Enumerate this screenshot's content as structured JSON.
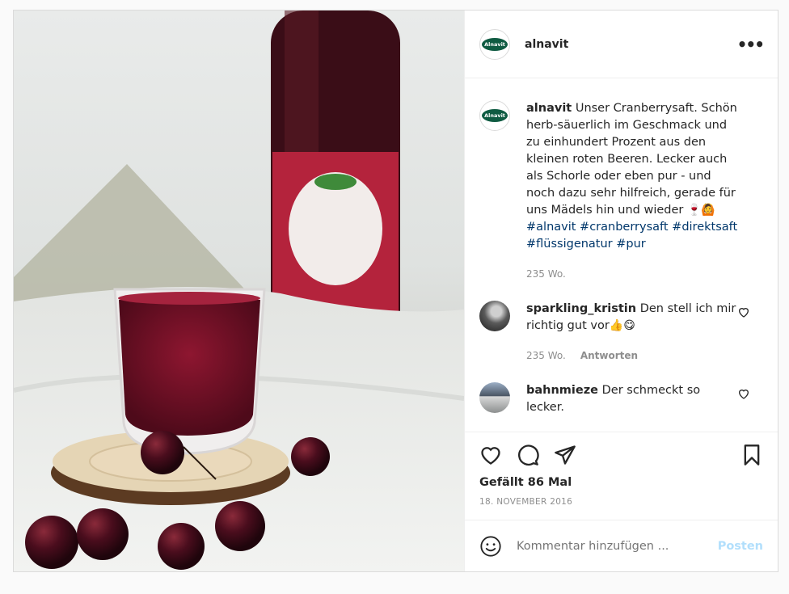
{
  "post": {
    "username": "alnavit",
    "logo_text": "Alnavit",
    "more_icon": "more-dots-icon",
    "caption": {
      "text": "Unser Cranberrysaft. Schön herb-säuerlich im Geschmack und zu einhundert Prozent aus den kleinen roten Beeren. Lecker auch als Schorle oder eben pur - und noch dazu sehr hilfreich, gerade für uns Mädels hin und wieder",
      "emoji": "🍷🙆",
      "hashtags": [
        "#alnavit",
        "#cranberrysaft",
        "#direktsaft",
        "#flüssigenatur",
        "#pur"
      ],
      "time": "235 Wo."
    },
    "comments": [
      {
        "user": "sparkling_kristin",
        "text": "Den stell ich mir richtig gut vor",
        "emoji": "👍😋",
        "time": "235 Wo.",
        "reply": "Antworten"
      },
      {
        "user": "bahnmieze",
        "text": "Der schmeckt so lecker."
      }
    ],
    "likes": "Gefällt 86 Mal",
    "date": "18. NOVEMBER 2016",
    "comment_placeholder": "Kommentar hinzufügen ...",
    "post_button": "Posten"
  }
}
